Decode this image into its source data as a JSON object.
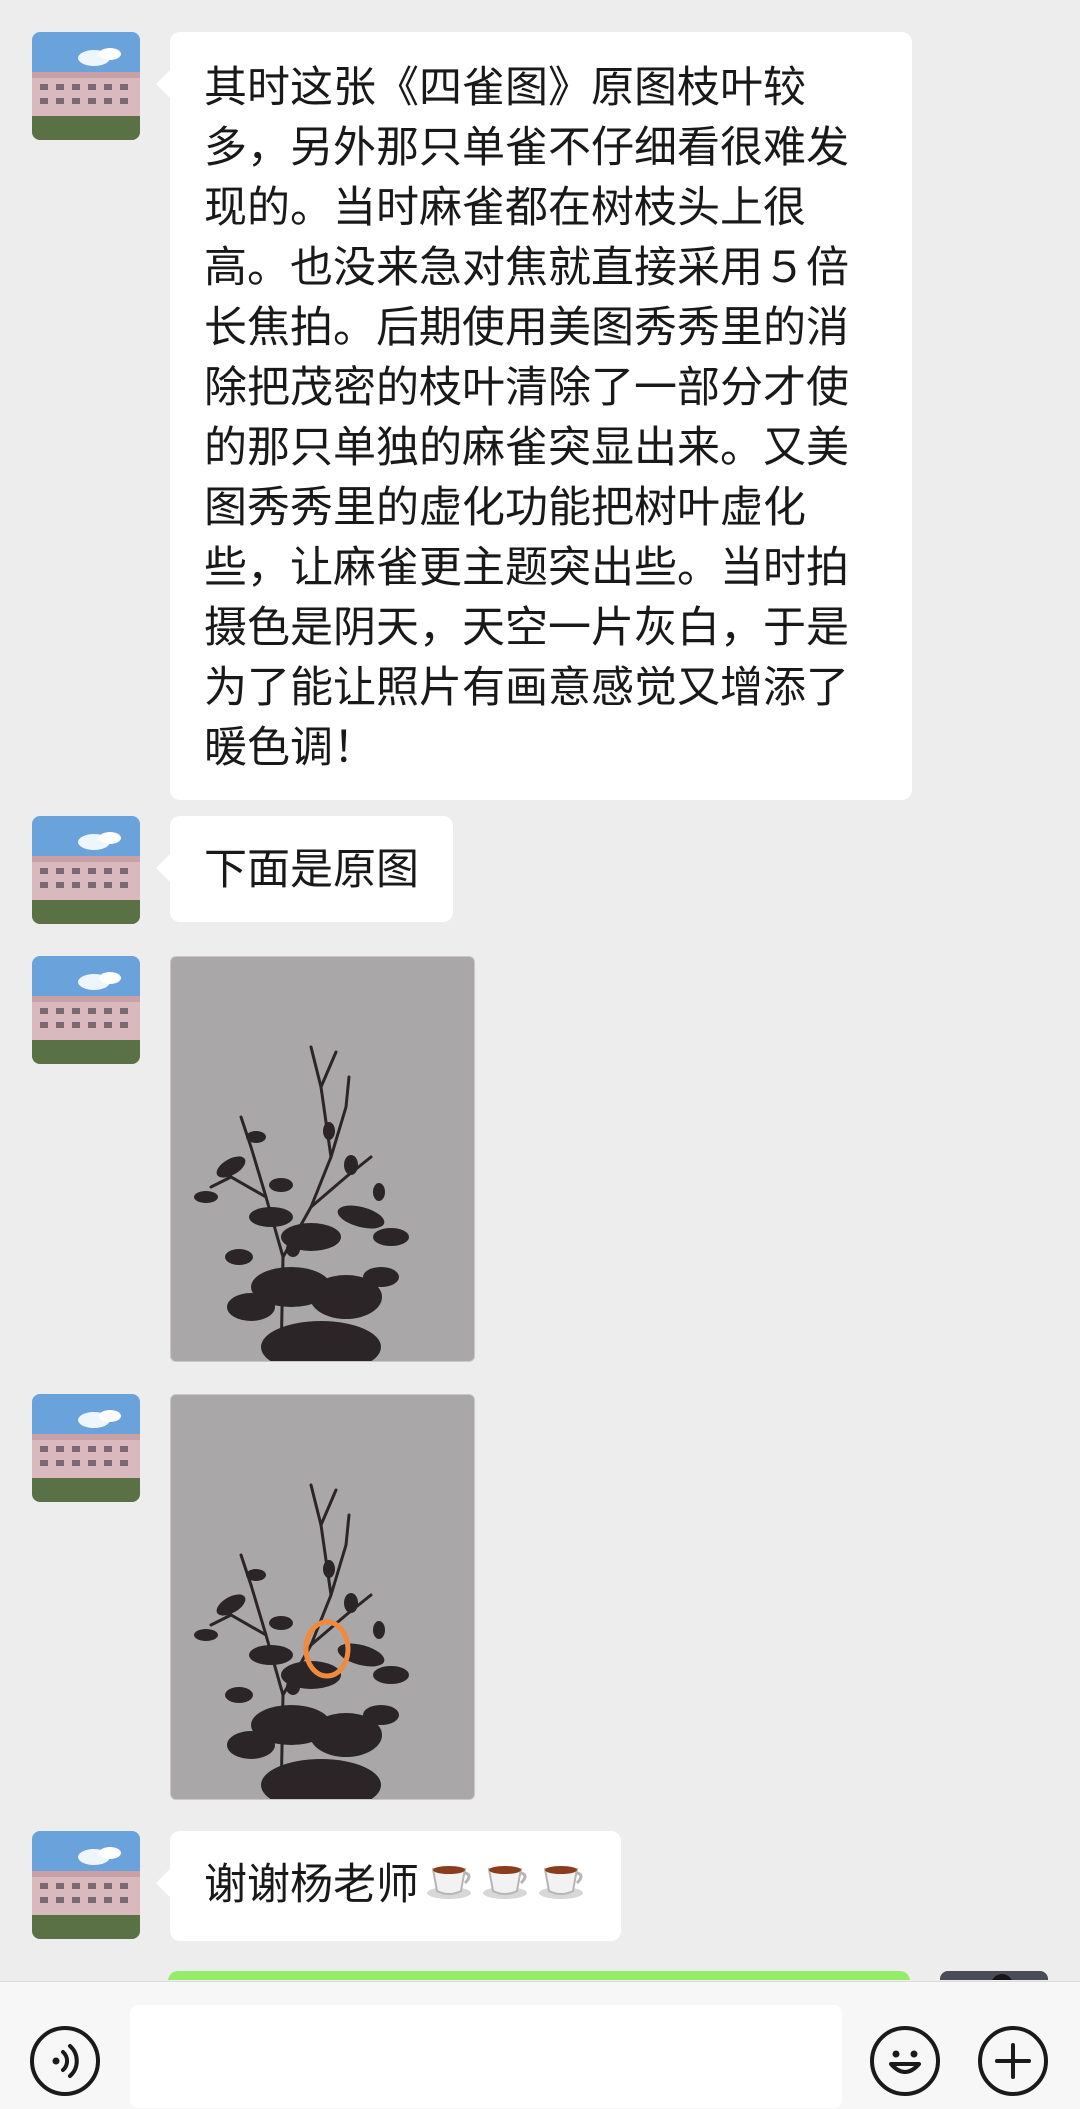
{
  "messages": {
    "text1": "其时这张《四雀图》原图枝叶较多，另外那只单雀不仔细看很难发现的。当时麻雀都在树枝头上很高。也没来急对焦就直接采用５倍长焦拍。后期使用美图秀秀里的消除把茂密的枝叶清除了一部分才使的那只单独的麻雀突显出来。又美图秀秀里的虚化功能把树叶虚化些，让麻雀更主题突出些。当时拍摄色是阴天，天空一片灰白，于是为了能让照片有画意感觉又增添了暖色调！",
    "text2": "下面是原图",
    "text3": "谢谢杨老师"
  },
  "icons": {
    "voice": "voice-icon",
    "emoji": "emoji-icon",
    "plus": "plus-icon",
    "cup": "hot-beverage-emoji"
  },
  "colors": {
    "chat_background": "#ededed",
    "incoming_bubble": "#ffffff",
    "outgoing_bubble": "#95ec69",
    "highlight_circle": "#f08a3c"
  }
}
